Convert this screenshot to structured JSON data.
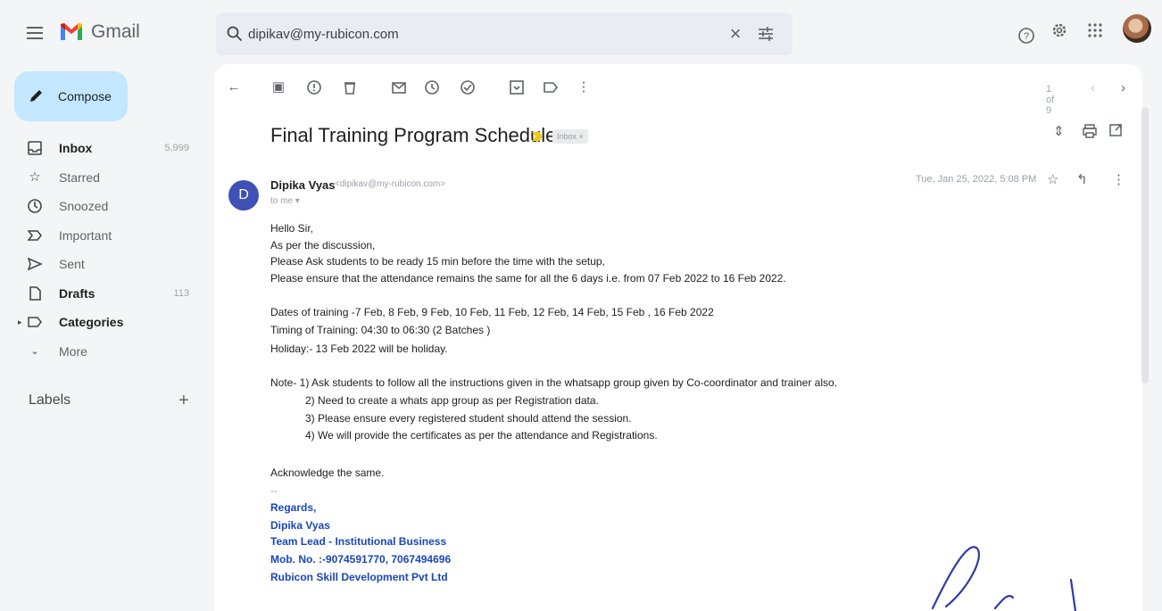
{
  "app": {
    "name": "Gmail",
    "colors": {
      "accent": "#c2e7ff",
      "important": "#f5c518",
      "signature": "#1a47b8",
      "avatar": "#3f51b5"
    }
  },
  "search": {
    "value": "dipikav@my-rubicon.com",
    "placeholder": ""
  },
  "sidebar": {
    "compose_label": "Compose",
    "items": [
      {
        "label": "Inbox",
        "count": "5,999",
        "icon": "inbox-icon"
      },
      {
        "label": "Starred",
        "count": "",
        "icon": "star-icon"
      },
      {
        "label": "Snoozed",
        "count": "",
        "icon": "clock-icon"
      },
      {
        "label": "Important",
        "count": "",
        "icon": "important-icon"
      },
      {
        "label": "Sent",
        "count": "",
        "icon": "send-icon"
      },
      {
        "label": "Drafts",
        "count": "113",
        "icon": "draft-icon"
      },
      {
        "label": "Categories",
        "count": "",
        "icon": "label-icon"
      },
      {
        "label": "More",
        "count": "",
        "icon": "chevron-down-icon"
      }
    ],
    "labels_heading": "Labels",
    "labels_add": "+"
  },
  "toolbar": {
    "pager": "1 of 9"
  },
  "email": {
    "subject": "Final Training Program Schedule",
    "label_badge": "Inbox ×",
    "sender_initial": "D",
    "sender_name": "Dipika Vyas",
    "sender_email": "<dipikav@my-rubicon.com>",
    "to": "to me ▾",
    "date": "Tue, Jan 25, 2022, 5:08 PM",
    "body": [
      "Hello Sir,",
      "As per the discussion,",
      "Please Ask students to be ready 15 min before the time with the setup,",
      "Please ensure that the attendance remains the same for all the 6 days i.e. from 07 Feb 2022 to 16 Feb 2022.",
      "Dates of training -7 Feb, 8 Feb, 9 Feb, 10 Feb, 11 Feb, 12 Feb, 14 Feb, 15 Feb , 16 Feb 2022",
      "Timing of Training:  04:30 to 06:30 (2 Batches )",
      "Holiday:- 13 Feb 2022 will be holiday.",
      "Note- 1) Ask students to follow all the instructions given in the whatsapp group given by Co-coordinator and trainer also.",
      "2) Need to create a whats app group as per Registration data.",
      "3) Please ensure every registered student should attend the session.",
      "4) We will provide the certificates as per the attendance and Registrations.",
      "Acknowledge the same.",
      "--"
    ],
    "signature": [
      "Regards,",
      "Dipika Vyas",
      "Team Lead - Institutional Business",
      "Mob. No. :-9074591770, 7067494696",
      "Rubicon Skill Development Pvt Ltd"
    ]
  }
}
